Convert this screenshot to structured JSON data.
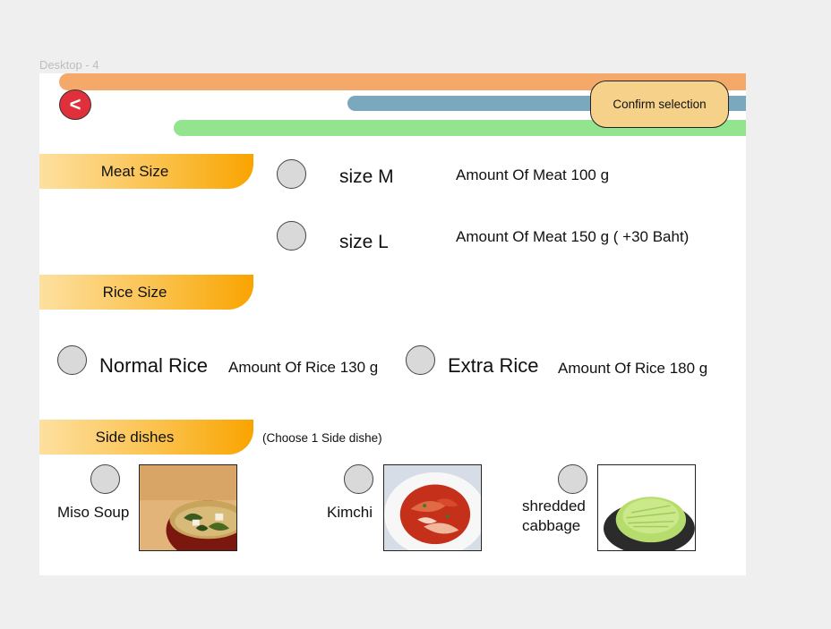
{
  "frame": {
    "label": "Desktop - 4"
  },
  "header": {
    "back_label": "<",
    "confirm_label": "Confirm selection"
  },
  "meat": {
    "title": "Meat Size",
    "options": [
      {
        "label": "size M",
        "amount": "Amount Of Meat 100 g"
      },
      {
        "label": "size L",
        "amount": "Amount Of Meat 150 g ( +30 Baht)"
      }
    ]
  },
  "rice": {
    "title": "Rice Size",
    "options": [
      {
        "label": "Normal Rice",
        "amount": "Amount Of Rice 130 g"
      },
      {
        "label": "Extra Rice",
        "amount": "Amount Of Rice 180 g"
      }
    ]
  },
  "side": {
    "title": "Side dishes",
    "note": "(Choose 1 Side dishe)",
    "options": [
      {
        "label": "Miso Soup",
        "image": "miso-soup-photo"
      },
      {
        "label": "Kimchi",
        "image": "kimchi-photo"
      },
      {
        "label_line1": "shredded",
        "label_line2": "cabbage",
        "image": "shredded-cabbage-photo"
      }
    ]
  },
  "colors": {
    "bar_orange": "#f4a96a",
    "bar_blue": "#7aa8bf",
    "bar_green": "#92e58e",
    "back_button": "#e0303b",
    "confirm_button": "#f6d18a",
    "section_tab_start": "#fde0a0",
    "section_tab_end": "#f9a400",
    "radio_fill": "#d9d9d9"
  }
}
